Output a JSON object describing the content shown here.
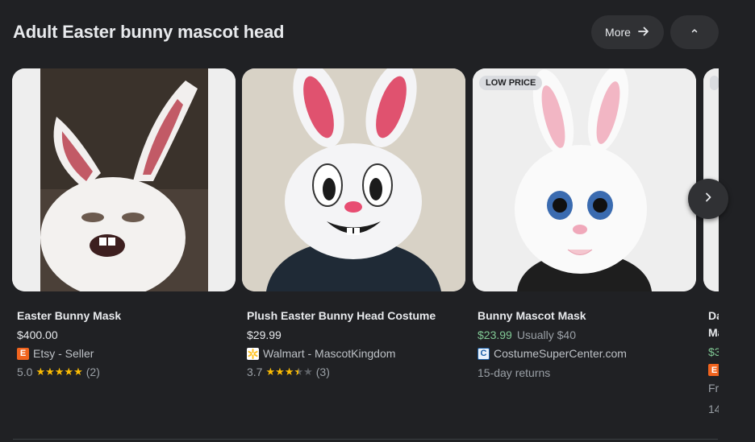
{
  "header": {
    "title": "Adult Easter bunny mascot head",
    "more_label": "More",
    "more_icon": "arrow-right-icon",
    "collapse_icon": "chevron-up-icon"
  },
  "products": [
    {
      "title": "Easter Bunny Mask",
      "price": "$400.00",
      "seller": "Etsy - Seller",
      "seller_icon_letter": "E",
      "rating": "5.0",
      "stars": 5,
      "reviews": "(2)"
    },
    {
      "title": "Plush Easter Bunny Head Costume",
      "price": "$29.99",
      "seller": "Walmart - MascotKingdom",
      "rating": "3.7",
      "stars": 3.5,
      "reviews": "(3)"
    },
    {
      "badge": "LOW PRICE",
      "title": "Bunny Mascot Mask",
      "price": "$23.99",
      "was_price": "Usually $40",
      "seller": "CostumeSuperCenter.com",
      "seller_icon_letter": "C",
      "returns": "15-day returns"
    },
    {
      "title": "Da",
      "title_line2": "Ma",
      "price": "$3",
      "seller_icon_letter": "E",
      "line_fr": "Fr",
      "line_14": "14"
    }
  ],
  "colors": {
    "background": "#202124",
    "sale_price": "#81c995",
    "star": "#fbbc04",
    "etsy": "#f1641e",
    "walmart": "#ffc220"
  }
}
